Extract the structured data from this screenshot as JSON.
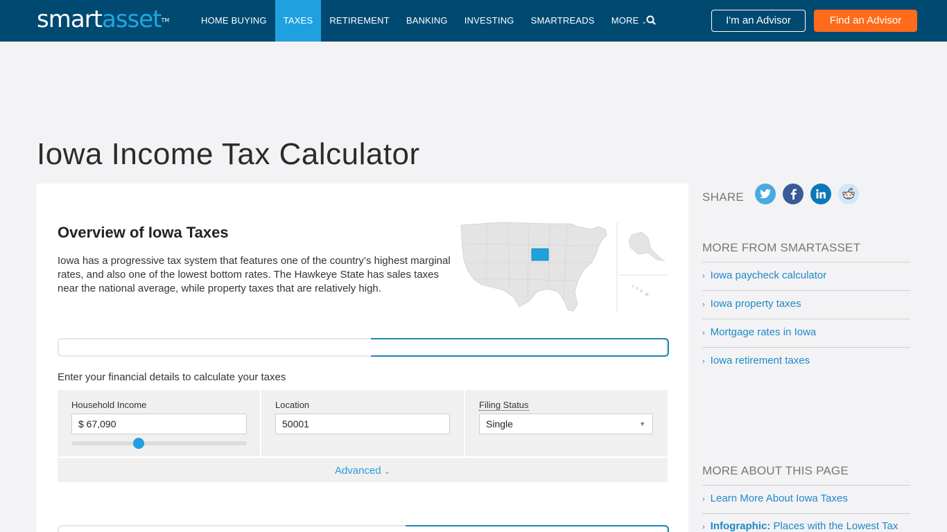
{
  "header": {
    "logo_smart": "smart",
    "logo_asset": "asset",
    "logo_tm": "TM",
    "nav": [
      {
        "label": "HOME BUYING"
      },
      {
        "label": "TAXES"
      },
      {
        "label": "RETIREMENT"
      },
      {
        "label": "BANKING"
      },
      {
        "label": "INVESTING"
      },
      {
        "label": "SMARTREADS"
      },
      {
        "label": "MORE"
      }
    ],
    "active_nav": "TAXES",
    "advisor_button": "I'm an Advisor",
    "find_button": "Find an Advisor",
    "search_icon": "search-icon"
  },
  "page_title": "Iowa Income Tax Calculator",
  "overview": {
    "title": "Overview of Iowa Taxes",
    "text": "Iowa has a progressive tax system that features one of the country’s highest marginal rates, and also one of the lowest bottom rates. The Hawkeye State has sales taxes near the national average, while property taxes that are relatively high."
  },
  "calculator": {
    "intro": "Enter your financial details to calculate your taxes",
    "income_label": "Household Income",
    "income_value": "$ 67,090",
    "slider_fraction": 0.385,
    "location_label": "Location",
    "location_value": "50001",
    "filing_label": "Filing Status",
    "filing_value": "Single",
    "advanced_label": "Advanced"
  },
  "sidebar": {
    "share_label": "SHARE",
    "social_icons": [
      "twitter-icon",
      "facebook-icon",
      "linkedin-icon",
      "reddit-icon"
    ],
    "more_from_title": "MORE FROM SMARTASSET",
    "more_from_links": [
      "Iowa paycheck calculator",
      "Iowa property taxes",
      "Mortgage rates in Iowa",
      "Iowa retirement taxes"
    ],
    "more_about_title": "MORE ABOUT THIS PAGE",
    "more_about_link1": "Learn More About Iowa Taxes",
    "more_about_link2_bold": "Infographic:",
    "more_about_link2_rest": " Places with the Lowest Tax"
  },
  "colors": {
    "header_bg": "#004a72",
    "accent_blue": "#1fa1e0",
    "cta_orange": "#ff6b1a",
    "link_blue": "#1e88c7",
    "iowa_highlight": "#1fa1e0"
  }
}
